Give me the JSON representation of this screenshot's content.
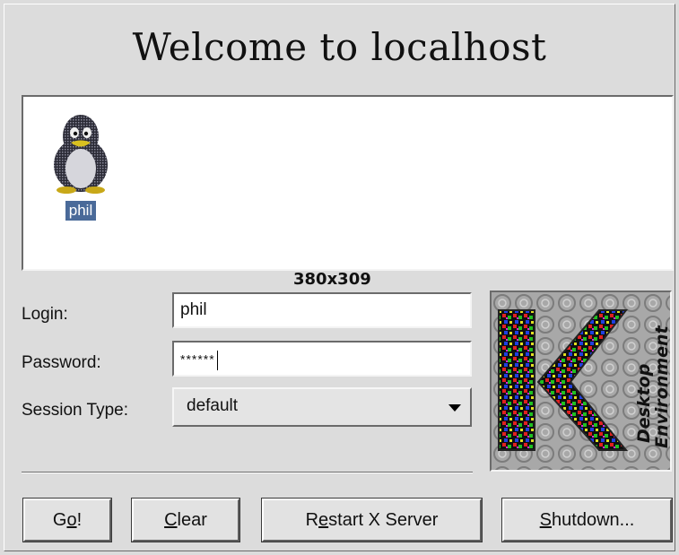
{
  "title": "Welcome to localhost",
  "users": [
    {
      "name": "phil",
      "icon": "tux-penguin-icon",
      "selected": true
    }
  ],
  "size_info": "380x309",
  "form": {
    "login_label": "Login:",
    "login_value": "phil",
    "password_label": "Password:",
    "password_value": "******",
    "session_label": "Session Type:",
    "session_value": "default"
  },
  "logo": {
    "icon": "kde-logo-icon",
    "text_line1": "Desktop",
    "text_line2": "Environment"
  },
  "buttons": {
    "go": {
      "pre": "G",
      "u": "o",
      "post": "!"
    },
    "clear": {
      "pre": "",
      "u": "C",
      "post": "lear"
    },
    "restart": {
      "pre": "R",
      "u": "e",
      "post": "start X Server"
    },
    "shutdown": {
      "pre": "",
      "u": "S",
      "post": "hutdown..."
    }
  },
  "colors": {
    "background": "#dcdcdc",
    "selection": "#4a6a99",
    "field_bg": "#ffffff"
  }
}
